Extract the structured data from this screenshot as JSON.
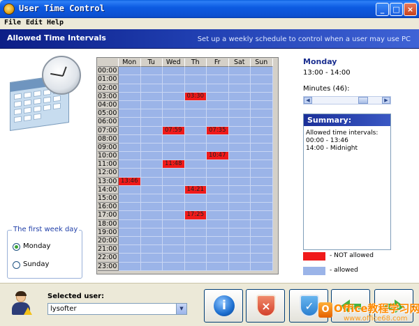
{
  "window": {
    "title": "User Time Control",
    "min": "_",
    "max": "□",
    "close": "×"
  },
  "menu": [
    "File",
    "Edit",
    "Help"
  ],
  "banner": {
    "title": "Allowed Time Intervals",
    "subtitle": "Set up a weekly schedule to control when a user may use PC"
  },
  "week": {
    "legend": "The first week day",
    "options": [
      {
        "label": "Monday",
        "checked": true
      },
      {
        "label": "Sunday",
        "checked": false
      }
    ]
  },
  "grid": {
    "days": [
      "Mon",
      "Tu",
      "Wed",
      "Th",
      "Fr",
      "Sat",
      "Sun"
    ],
    "hours": [
      "00:00",
      "01:00",
      "02:00",
      "03:00",
      "04:00",
      "05:00",
      "06:00",
      "07:00",
      "08:00",
      "09:00",
      "10:00",
      "11:00",
      "12:00",
      "13:00",
      "14:00",
      "15:00",
      "16:00",
      "17:00",
      "18:00",
      "19:00",
      "20:00",
      "21:00",
      "22:00",
      "23:00"
    ],
    "blocked": [
      {
        "hour": 3,
        "day": 3,
        "label": "03:30"
      },
      {
        "hour": 7,
        "day": 2,
        "label": "07:59"
      },
      {
        "hour": 7,
        "day": 4,
        "label": "07:35"
      },
      {
        "hour": 10,
        "day": 4,
        "label": "10:47"
      },
      {
        "hour": 11,
        "day": 2,
        "label": "11:48"
      },
      {
        "hour": 13,
        "day": 0,
        "label": "13:46"
      },
      {
        "hour": 14,
        "day": 3,
        "label": "14:21"
      },
      {
        "hour": 17,
        "day": 3,
        "label": "17:25"
      }
    ]
  },
  "details": {
    "day": "Monday",
    "time_range": "13:00 - 14:00",
    "minutes_label": "Minutes (46):",
    "minutes_value": 46,
    "minutes_max": 60
  },
  "summary": {
    "title": "Summary:",
    "lines": [
      "Allowed time intervals:",
      "00:00 - 13:46",
      "14:00 - Midnight"
    ]
  },
  "legend": {
    "blocked_label": "- NOT allowed",
    "allowed_label": "- allowed",
    "blocked_color": "#f01a1a",
    "allowed_color": "#9bb4e8"
  },
  "user": {
    "label": "Selected user:",
    "value": "lysofter"
  },
  "buttons": {
    "info": "i",
    "cancel": "×",
    "ok": "✓"
  },
  "watermark": {
    "top": "Office教程学习网",
    "bottom": "www.office68.com",
    "logo": "O"
  }
}
